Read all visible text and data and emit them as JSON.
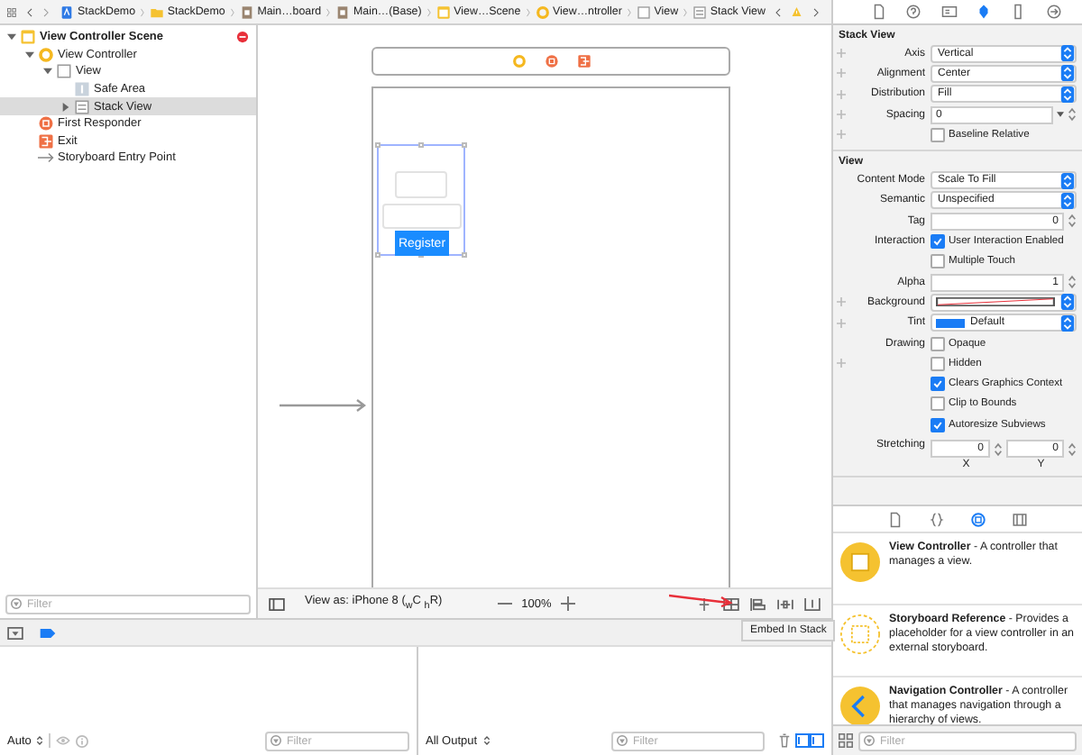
{
  "breadcrumbs": [
    {
      "label": "StackDemo",
      "kind": "project"
    },
    {
      "label": "StackDemo",
      "kind": "folder"
    },
    {
      "label": "Main…board",
      "kind": "storyboard"
    },
    {
      "label": "Main…(Base)",
      "kind": "storyboard"
    },
    {
      "label": "View…Scene",
      "kind": "scene"
    },
    {
      "label": "View…ntroller",
      "kind": "controller"
    },
    {
      "label": "View",
      "kind": "view"
    },
    {
      "label": "Stack View",
      "kind": "stack"
    }
  ],
  "inspector_tabs": [
    {
      "kind": "file",
      "selected": false
    },
    {
      "kind": "help",
      "selected": false
    },
    {
      "kind": "identity",
      "selected": false
    },
    {
      "kind": "attributes",
      "selected": true
    },
    {
      "kind": "size",
      "selected": false
    },
    {
      "kind": "connections",
      "selected": false
    }
  ],
  "outline": {
    "items": [
      {
        "label": "View Controller Scene",
        "kind": "scene",
        "expanded": true,
        "selected": false,
        "error": true,
        "children": [
          {
            "label": "View Controller",
            "kind": "controller",
            "expanded": true,
            "selected": false,
            "children": [
              {
                "label": "View",
                "kind": "view",
                "expanded": true,
                "selected": false,
                "children": [
                  {
                    "label": "Safe Area",
                    "kind": "safearea",
                    "selected": false
                  },
                  {
                    "label": "Stack View",
                    "kind": "stack",
                    "expanded": false,
                    "selected": true
                  }
                ]
              }
            ]
          },
          {
            "label": "First Responder",
            "kind": "responder",
            "selected": false
          },
          {
            "label": "Exit",
            "kind": "exit",
            "selected": false
          },
          {
            "label": "Storyboard Entry Point",
            "kind": "entry",
            "selected": false
          }
        ]
      }
    ],
    "filter": {
      "placeholder": "Filter"
    }
  },
  "canvas": {
    "button_label": "Register",
    "view_as": "View as: iPhone 8 ($_{w}$C $_{h}$R)",
    "zoom": "100%",
    "tooltip": "Embed In Stack"
  },
  "debug": {
    "scope": "Auto",
    "variables_filter": {
      "placeholder": "Filter"
    },
    "output": "All Output",
    "console_filter": {
      "placeholder": "Filter"
    }
  },
  "inspector": [
    {
      "title": "Stack View",
      "rows": [
        {
          "kind": "select",
          "label": "Axis",
          "value": "Vertical",
          "plus": true
        },
        {
          "kind": "select",
          "label": "Alignment",
          "value": "Center",
          "plus": true
        },
        {
          "kind": "select",
          "label": "Distribution",
          "value": "Fill",
          "plus": true
        },
        {
          "kind": "combo",
          "label": "Spacing",
          "value": "0",
          "plus": true
        },
        {
          "kind": "checkbox",
          "text": "Baseline Relative",
          "checked": false,
          "plus": true
        }
      ]
    },
    {
      "title": "View",
      "rows": [
        {
          "kind": "select",
          "label": "Content Mode",
          "value": "Scale To Fill",
          "plus": false
        },
        {
          "kind": "select",
          "label": "Semantic",
          "value": "Unspecified",
          "plus": false
        },
        {
          "kind": "number",
          "label": "Tag",
          "value": "0",
          "plus": false
        },
        {
          "kind": "checkbox",
          "label": "Interaction",
          "text": "User Interaction Enabled",
          "checked": true,
          "plus": false
        },
        {
          "kind": "checkbox",
          "text": "Multiple Touch",
          "checked": false,
          "plus": false
        },
        {
          "kind": "number",
          "label": "Alpha",
          "value": "1",
          "plus": false
        },
        {
          "kind": "color",
          "label": "Background",
          "plus": true
        },
        {
          "kind": "color",
          "label": "Tint",
          "color": "#1a7cf5",
          "value": "Default",
          "plus": true
        },
        {
          "kind": "checkbox",
          "label": "Drawing",
          "text": "Opaque",
          "checked": false,
          "plus": false
        },
        {
          "kind": "checkbox",
          "text": "Hidden",
          "checked": false,
          "plus": true
        },
        {
          "kind": "checkbox",
          "text": "Clears Graphics Context",
          "checked": true,
          "plus": false
        },
        {
          "kind": "checkbox",
          "text": "Clip to Bounds",
          "checked": false,
          "plus": false
        },
        {
          "kind": "checkbox",
          "text": "Autoresize Subviews",
          "checked": true,
          "plus": false
        },
        {
          "kind": "pair",
          "label": "Stretching",
          "values": [
            {
              "value": "0",
              "caption": "X"
            },
            {
              "value": "0",
              "caption": "Y"
            }
          ],
          "plus": false
        }
      ]
    }
  ],
  "library": {
    "tabs": [
      {
        "kind": "file",
        "selected": false
      },
      {
        "kind": "code",
        "selected": false
      },
      {
        "kind": "object",
        "selected": true
      },
      {
        "kind": "media",
        "selected": false
      }
    ],
    "items": [
      {
        "kind": "controller",
        "text": "**View Controller** - A controller that manages a view."
      },
      {
        "kind": "reference",
        "text": "**Storyboard Reference** - Provides a placeholder for a view controller in an external storyboard."
      },
      {
        "kind": "navigation",
        "text": "**Navigation Controller** - A controller that manages navigation through a hierarchy of views."
      }
    ],
    "filter": {
      "placeholder": "Filter"
    }
  }
}
